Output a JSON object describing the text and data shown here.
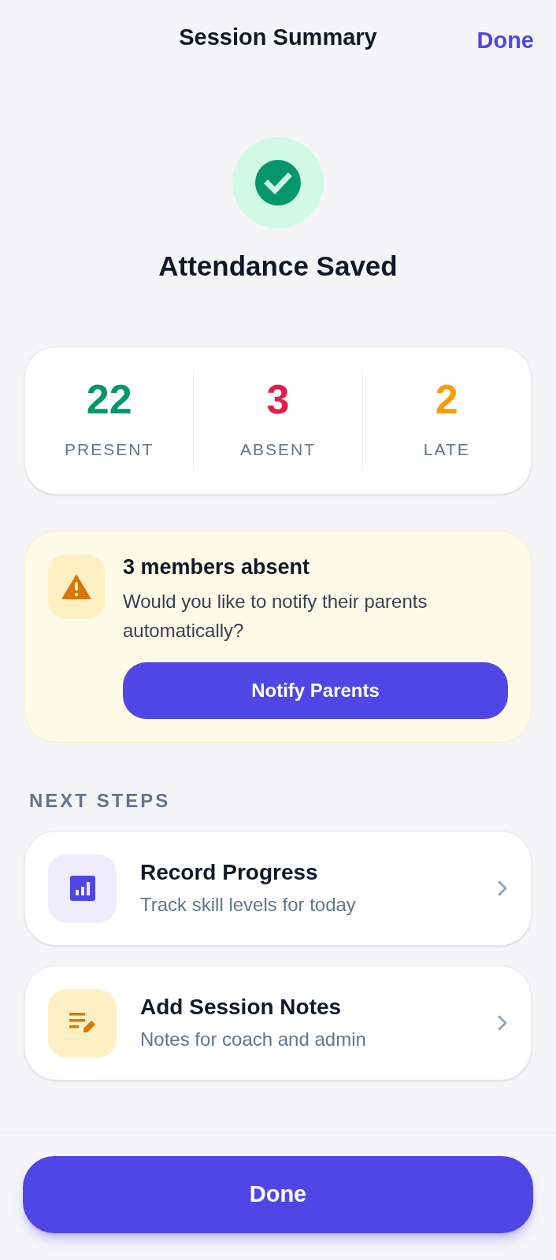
{
  "header": {
    "title": "Session Summary",
    "action": "Done"
  },
  "status": {
    "title": "Attendance Saved"
  },
  "stats": [
    {
      "value": "22",
      "label": "PRESENT",
      "color": "#059669"
    },
    {
      "value": "3",
      "label": "ABSENT",
      "color": "#e11d48"
    },
    {
      "value": "2",
      "label": "LATE",
      "color": "#f59e0b"
    }
  ],
  "alert": {
    "title": "3 members absent",
    "message": "Would you like to notify their parents automatically?",
    "button": "Notify Parents"
  },
  "next_steps": {
    "heading": "NEXT STEPS",
    "items": [
      {
        "kind": "progress",
        "title": "Record Progress",
        "subtitle": "Track skill levels for today"
      },
      {
        "kind": "notes",
        "title": "Add Session Notes",
        "subtitle": "Notes for coach and admin"
      }
    ]
  },
  "footer": {
    "button": "Done"
  }
}
